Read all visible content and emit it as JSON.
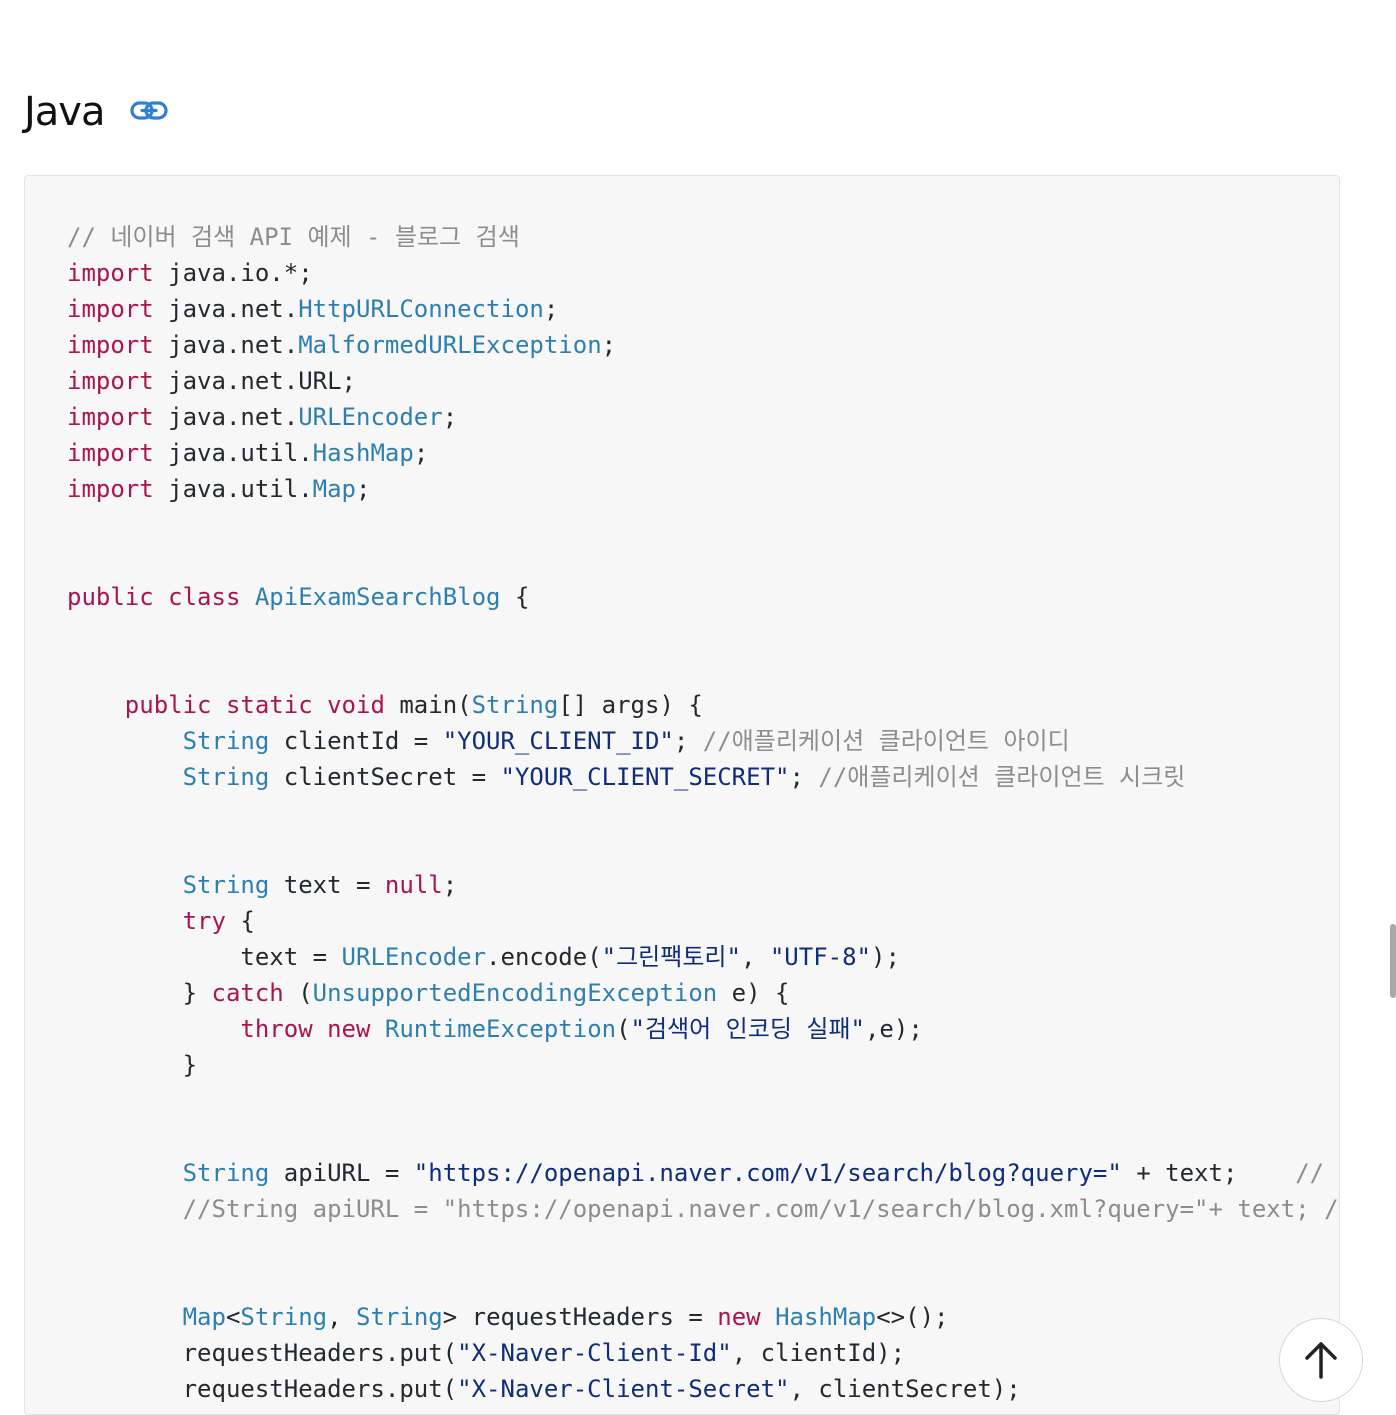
{
  "heading": {
    "title": "Java",
    "link_icon": "link-icon"
  },
  "code": {
    "lines": [
      [
        {
          "t": "// 네이버 검색 API 예제 - 블로그 검색",
          "c": "cm"
        }
      ],
      [
        {
          "t": "import",
          "c": "kw"
        },
        {
          "t": " java.io.*;"
        }
      ],
      [
        {
          "t": "import",
          "c": "kw"
        },
        {
          "t": " java.net."
        },
        {
          "t": "HttpURLConnection",
          "c": "ty"
        },
        {
          "t": ";"
        }
      ],
      [
        {
          "t": "import",
          "c": "kw"
        },
        {
          "t": " java.net."
        },
        {
          "t": "MalformedURLException",
          "c": "ty"
        },
        {
          "t": ";"
        }
      ],
      [
        {
          "t": "import",
          "c": "kw"
        },
        {
          "t": " java.net.URL;"
        }
      ],
      [
        {
          "t": "import",
          "c": "kw"
        },
        {
          "t": " java.net."
        },
        {
          "t": "URLEncoder",
          "c": "ty"
        },
        {
          "t": ";"
        }
      ],
      [
        {
          "t": "import",
          "c": "kw"
        },
        {
          "t": " java.util."
        },
        {
          "t": "HashMap",
          "c": "ty"
        },
        {
          "t": ";"
        }
      ],
      [
        {
          "t": "import",
          "c": "kw"
        },
        {
          "t": " java.util."
        },
        {
          "t": "Map",
          "c": "ty"
        },
        {
          "t": ";"
        }
      ],
      [],
      [],
      [
        {
          "t": "public",
          "c": "kw"
        },
        {
          "t": " "
        },
        {
          "t": "class",
          "c": "kw"
        },
        {
          "t": " "
        },
        {
          "t": "ApiExamSearchBlog",
          "c": "ty"
        },
        {
          "t": " {"
        }
      ],
      [],
      [],
      [
        {
          "t": "    "
        },
        {
          "t": "public",
          "c": "kw"
        },
        {
          "t": " "
        },
        {
          "t": "static",
          "c": "kw"
        },
        {
          "t": " "
        },
        {
          "t": "void",
          "c": "kw"
        },
        {
          "t": " main("
        },
        {
          "t": "String",
          "c": "ty"
        },
        {
          "t": "[] args) {"
        }
      ],
      [
        {
          "t": "        "
        },
        {
          "t": "String",
          "c": "ty"
        },
        {
          "t": " clientId = "
        },
        {
          "t": "\"YOUR_CLIENT_ID\"",
          "c": "st"
        },
        {
          "t": "; "
        },
        {
          "t": "//애플리케이션 클라이언트 아이디",
          "c": "cm"
        }
      ],
      [
        {
          "t": "        "
        },
        {
          "t": "String",
          "c": "ty"
        },
        {
          "t": " clientSecret = "
        },
        {
          "t": "\"YOUR_CLIENT_SECRET\"",
          "c": "st"
        },
        {
          "t": "; "
        },
        {
          "t": "//애플리케이션 클라이언트 시크릿",
          "c": "cm"
        }
      ],
      [],
      [],
      [
        {
          "t": "        "
        },
        {
          "t": "String",
          "c": "ty"
        },
        {
          "t": " text = "
        },
        {
          "t": "null",
          "c": "kw"
        },
        {
          "t": ";"
        }
      ],
      [
        {
          "t": "        "
        },
        {
          "t": "try",
          "c": "kw"
        },
        {
          "t": " {"
        }
      ],
      [
        {
          "t": "            text = "
        },
        {
          "t": "URLEncoder",
          "c": "ty"
        },
        {
          "t": ".encode("
        },
        {
          "t": "\"그린팩토리\"",
          "c": "st"
        },
        {
          "t": ", "
        },
        {
          "t": "\"UTF-8\"",
          "c": "st"
        },
        {
          "t": ");"
        }
      ],
      [
        {
          "t": "        } "
        },
        {
          "t": "catch",
          "c": "kw"
        },
        {
          "t": " ("
        },
        {
          "t": "UnsupportedEncodingException",
          "c": "ty"
        },
        {
          "t": " e) {"
        }
      ],
      [
        {
          "t": "            "
        },
        {
          "t": "throw",
          "c": "kw"
        },
        {
          "t": " "
        },
        {
          "t": "new",
          "c": "kw"
        },
        {
          "t": " "
        },
        {
          "t": "RuntimeException",
          "c": "ty"
        },
        {
          "t": "("
        },
        {
          "t": "\"검색어 인코딩 실패\"",
          "c": "st"
        },
        {
          "t": ",e);"
        }
      ],
      [
        {
          "t": "        }"
        }
      ],
      [],
      [],
      [
        {
          "t": "        "
        },
        {
          "t": "String",
          "c": "ty"
        },
        {
          "t": " apiURL = "
        },
        {
          "t": "\"https://openapi.naver.com/v1/search/blog?query=\"",
          "c": "st"
        },
        {
          "t": " + text;    "
        },
        {
          "t": "// JSON 결과",
          "c": "cm"
        }
      ],
      [
        {
          "t": "        "
        },
        {
          "t": "//String apiURL = \"https://openapi.naver.com/v1/search/blog.xml?query=\"+ text; // XML 결과",
          "c": "cm"
        }
      ],
      [],
      [],
      [
        {
          "t": "        "
        },
        {
          "t": "Map",
          "c": "ty"
        },
        {
          "t": "<"
        },
        {
          "t": "String",
          "c": "ty"
        },
        {
          "t": ", "
        },
        {
          "t": "String",
          "c": "ty"
        },
        {
          "t": "> requestHeaders = "
        },
        {
          "t": "new",
          "c": "kw"
        },
        {
          "t": " "
        },
        {
          "t": "HashMap",
          "c": "ty"
        },
        {
          "t": "<>();"
        }
      ],
      [
        {
          "t": "        requestHeaders.put("
        },
        {
          "t": "\"X-Naver-Client-Id\"",
          "c": "st"
        },
        {
          "t": ", clientId);"
        }
      ],
      [
        {
          "t": "        requestHeaders.put("
        },
        {
          "t": "\"X-Naver-Client-Secret\"",
          "c": "st"
        },
        {
          "t": ", clientSecret);"
        }
      ]
    ]
  },
  "scroll_top_button": {
    "icon": "arrow-up-icon"
  }
}
